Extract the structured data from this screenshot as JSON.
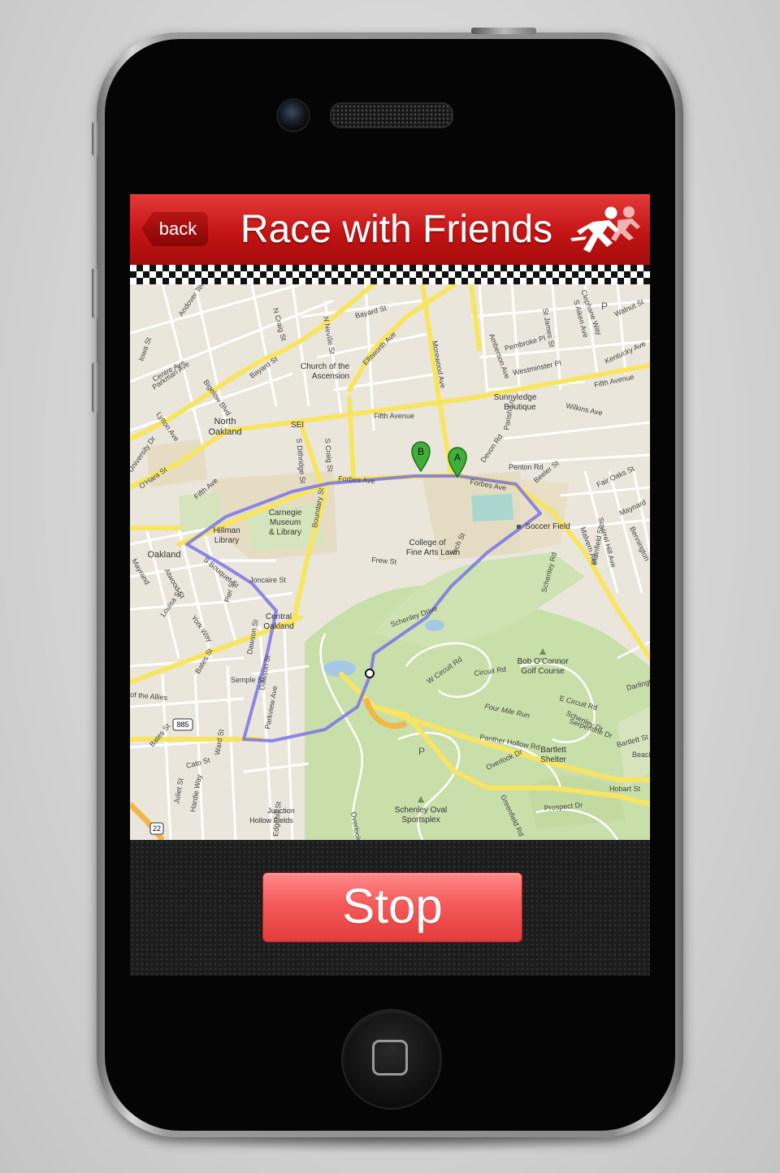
{
  "header": {
    "back_label": "back",
    "title": "Race with Friends"
  },
  "map": {
    "marker_a": "A",
    "marker_b": "B",
    "places": [
      {
        "id": "north-oakland",
        "text": "North"
      },
      {
        "id": "north-oakland2",
        "text": "Oakland"
      },
      {
        "id": "church",
        "text": "Church of the"
      },
      {
        "id": "church2",
        "text": "Ascension"
      },
      {
        "id": "sunnyledge",
        "text": "Sunnyledge"
      },
      {
        "id": "sunnyledge2",
        "text": "Boutique"
      },
      {
        "id": "carnegie",
        "text": "Carnegie"
      },
      {
        "id": "carnegie2",
        "text": "Museum"
      },
      {
        "id": "carnegie3",
        "text": "& Library"
      },
      {
        "id": "hillman",
        "text": "Hillman"
      },
      {
        "id": "hillman2",
        "text": "Library"
      },
      {
        "id": "cfa",
        "text": "College of"
      },
      {
        "id": "cfa2",
        "text": "Fine Arts Lawn"
      },
      {
        "id": "soccer",
        "text": "Soccer Field"
      },
      {
        "id": "oakland",
        "text": "Oakland"
      },
      {
        "id": "central",
        "text": "Central"
      },
      {
        "id": "central2",
        "text": "Oakland"
      },
      {
        "id": "bob",
        "text": "Bob O'Connor"
      },
      {
        "id": "bob2",
        "text": "Golf Course"
      },
      {
        "id": "bartlett",
        "text": "Bartlett"
      },
      {
        "id": "bartlett2",
        "text": "Shelter"
      },
      {
        "id": "oval",
        "text": "Schenley Oval"
      },
      {
        "id": "oval2",
        "text": "Sportsplex"
      },
      {
        "id": "junction",
        "text": "Junction"
      },
      {
        "id": "junction2",
        "text": "Hollow Fields"
      },
      {
        "id": "sei",
        "text": "SEI"
      }
    ],
    "streets": [
      "Fifth Avenue",
      "Forbes Ave",
      "Morewood Ave",
      "Centre Ave",
      "Bayard St",
      "Ellsworth Ave",
      "N Craig St",
      "N Neville St",
      "Frew St",
      "Tech St",
      "Schenley Drive",
      "Panther Hollow Rd",
      "Boundary St",
      "Joncaire St",
      "Dawson St",
      "Parkview Ave",
      "Bates St",
      "Four Mile Run",
      "Wilkins Ave",
      "Fifth Avenue",
      "Beeler St",
      "Penton Rd",
      "Devon Rd",
      "Schenley Rd",
      "Circuit Rd",
      "W Circuit Rd",
      "Overlook Dr",
      "Prospect Dr",
      "Hobart St",
      "Greenfield Rd",
      "Fair Oaks St",
      "Maynard",
      "Kentucky Ave",
      "Walnut St",
      "Pembroke Pl",
      "Westminster Pl",
      "Amberson Ave",
      "S Craig St",
      "Lytton Ave",
      "Parkman Ave",
      "Bigelow Blvd",
      "Bayard St",
      "Semple St",
      "York Way",
      "Louisa St",
      "Atwood St",
      "Mayrand",
      "Edgehill St",
      "Cato St",
      "Juliet St",
      "Hardie Way",
      "Ward St",
      "S Bouquet St",
      "Pier St",
      "S Dithridge St",
      "Serpentine Dr",
      "Bartlett St",
      "Darlington",
      "Malvern Ave",
      "Squirrel Hill Ave",
      "Plainfield St",
      "Bennington",
      "O'Hara St",
      "University Dr",
      "Andover Terr",
      "Iowa St",
      "Parish Ln",
      "S Aiken Ave",
      "St James St",
      "Clephane Way",
      "Beach",
      "Overlook Dr",
      "Schenley Dr",
      "E Circuit Rd",
      "Forbes Ave",
      "Fifth Ave",
      "Bates St",
      "Dawson St",
      "of the Allies"
    ],
    "highway_badges": [
      "885",
      "22"
    ],
    "park_marker": "P"
  },
  "bottom": {
    "stop_label": "Stop"
  }
}
